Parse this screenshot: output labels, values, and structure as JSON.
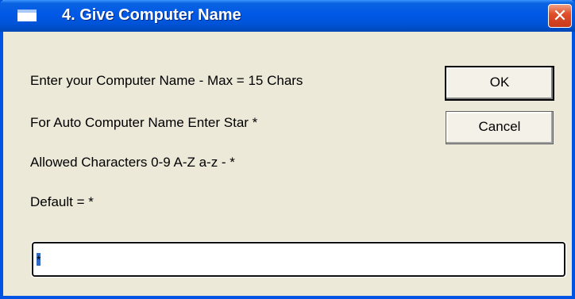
{
  "window": {
    "title": "4. Give Computer Name",
    "icon": "window-icon",
    "close_icon": "close-icon"
  },
  "labels": {
    "line1": "Enter your Computer Name - Max = 15 Chars",
    "line2": "For Auto Computer Name Enter Star *",
    "line3": "Allowed Characters 0-9 A-Z a-z - *",
    "line4": "Default = *"
  },
  "buttons": {
    "ok": "OK",
    "cancel": "Cancel"
  },
  "input": {
    "value": "*"
  },
  "colors": {
    "titlebar": "#0054e3",
    "dialog_bg": "#ece9d8",
    "close_button": "#e0502c",
    "selection": "#316ac5"
  }
}
